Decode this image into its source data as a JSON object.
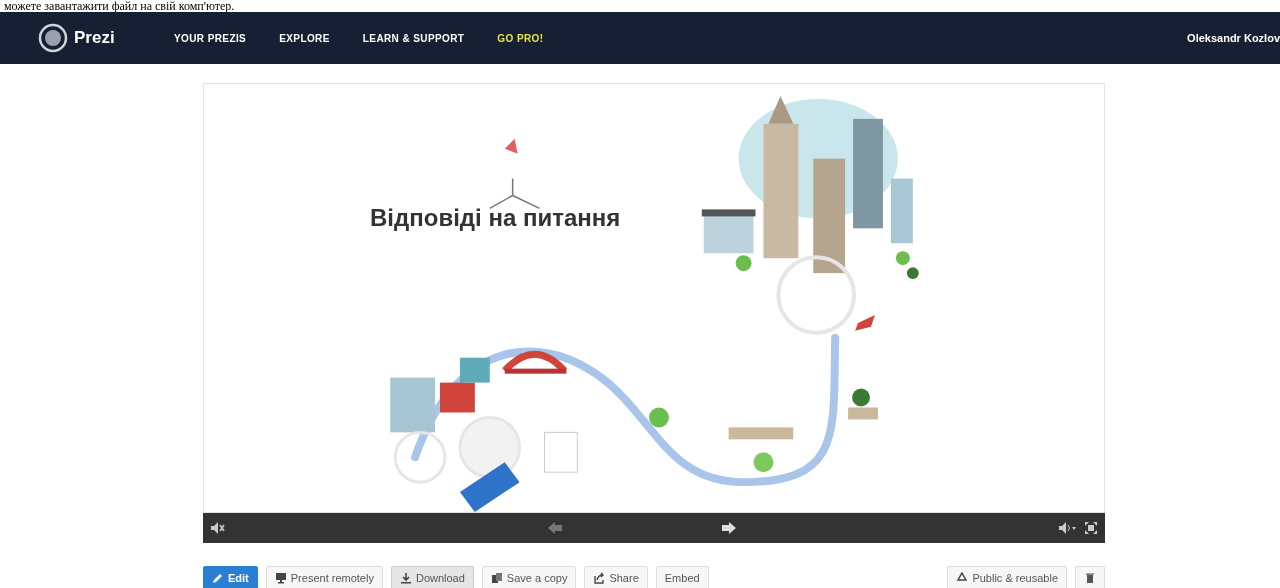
{
  "top_text": "можете завантажити файл на свій комп'ютер.",
  "nav": {
    "logo": "Prezi",
    "items": [
      {
        "label": "YOUR PREZIS",
        "kind": "normal"
      },
      {
        "label": "EXPLORE",
        "kind": "normal"
      },
      {
        "label": "LEARN & SUPPORT",
        "kind": "normal"
      },
      {
        "label": "GO PRO!",
        "kind": "promo"
      }
    ],
    "user": "Oleksandr Kozlov"
  },
  "presentation": {
    "title": "Відповіді на питання"
  },
  "actions": [
    {
      "label": "Edit",
      "kind": "primary"
    },
    {
      "label": "Present remotely",
      "kind": "normal"
    },
    {
      "label": "Download",
      "kind": "pressed"
    },
    {
      "label": "Save a copy",
      "kind": "normal"
    },
    {
      "label": "Share",
      "kind": "normal"
    },
    {
      "label": "Embed",
      "kind": "normal"
    }
  ],
  "visibility": {
    "label": "Public & reusable"
  }
}
